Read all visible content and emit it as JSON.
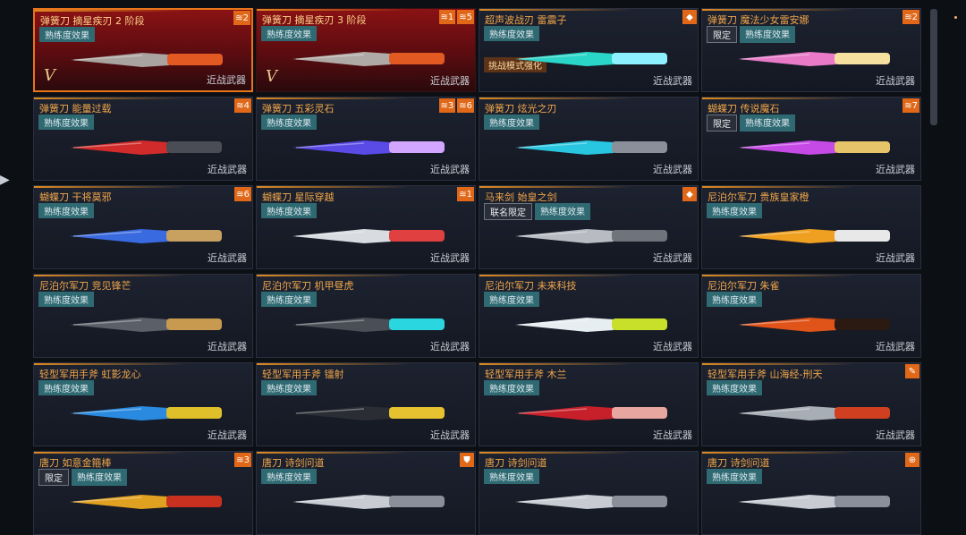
{
  "cards": [
    {
      "title": "弹簧刀 摘星疾刃 2 阶段",
      "tags": [
        {
          "t": "熟练度效果",
          "k": "fx"
        }
      ],
      "category": "近战武器",
      "badges": [
        "≋2"
      ],
      "style": "red sel",
      "v": "V",
      "c1": "#a9a4a0",
      "c2": "#e25a22"
    },
    {
      "title": "弹簧刀 摘星疾刃 3 阶段",
      "tags": [
        {
          "t": "熟练度效果",
          "k": "fx"
        }
      ],
      "category": "近战武器",
      "badges": [
        "≋1",
        "≋5"
      ],
      "style": "red",
      "v": "V",
      "c1": "#b0aaa6",
      "c2": "#e25a22"
    },
    {
      "title": "超声波战刃 雷震子",
      "tags": [
        {
          "t": "熟练度效果",
          "k": "fx"
        }
      ],
      "mode": "挑战模式强化",
      "category": "近战武器",
      "badges": [
        "◆"
      ],
      "style": "",
      "c1": "#2ad6c8",
      "c2": "#8cf0ff"
    },
    {
      "title": "弹簧刀 魔法少女雷安娜",
      "tags": [
        {
          "t": "限定",
          "k": "limit2"
        },
        {
          "t": "熟练度效果",
          "k": "fx"
        }
      ],
      "category": "近战武器",
      "badges": [
        "≋2"
      ],
      "style": "",
      "c1": "#e87ac8",
      "c2": "#f5e0a0"
    },
    {
      "title": "弹簧刀 能量过载",
      "tags": [
        {
          "t": "熟练度效果",
          "k": "fx"
        }
      ],
      "category": "近战武器",
      "badges": [
        "≋4"
      ],
      "style": "",
      "c1": "#d22b2b",
      "c2": "#4a4d55"
    },
    {
      "title": "弹簧刀 五彩灵石",
      "tags": [
        {
          "t": "熟练度效果",
          "k": "fx"
        }
      ],
      "category": "近战武器",
      "badges": [
        "≋3",
        "≋6"
      ],
      "style": "",
      "c1": "#5a4ae6",
      "c2": "#d2a6ff"
    },
    {
      "title": "弹簧刀 炫光之刃",
      "tags": [
        {
          "t": "熟练度效果",
          "k": "fx"
        }
      ],
      "category": "近战武器",
      "badges": [],
      "style": "",
      "c1": "#28c6e0",
      "c2": "#8a8f99"
    },
    {
      "title": "蝴蝶刀 传说魔石",
      "tags": [
        {
          "t": "限定",
          "k": "limit2"
        },
        {
          "t": "熟练度效果",
          "k": "fx"
        }
      ],
      "category": "近战武器",
      "badges": [
        "≋7"
      ],
      "style": "",
      "c1": "#c64ae6",
      "c2": "#e6c46a"
    },
    {
      "title": "蝴蝶刀 干将莫邪",
      "tags": [
        {
          "t": "熟练度效果",
          "k": "fx"
        }
      ],
      "category": "近战武器",
      "badges": [
        "≋6"
      ],
      "style": "",
      "c1": "#3a6ae0",
      "c2": "#c8a060"
    },
    {
      "title": "蝴蝶刀 星际穿越",
      "tags": [
        {
          "t": "熟练度效果",
          "k": "fx"
        }
      ],
      "category": "近战武器",
      "badges": [
        "≋1"
      ],
      "style": "",
      "c1": "#d8dbe0",
      "c2": "#e04040"
    },
    {
      "title": "马来剑 始皇之剑",
      "tags": [
        {
          "t": "联名限定",
          "k": "limit2"
        },
        {
          "t": "熟练度效果",
          "k": "fx"
        }
      ],
      "category": "近战武器",
      "badges": [
        "◆"
      ],
      "style": "",
      "c1": "#b8bcc2",
      "c2": "#6f747c"
    },
    {
      "title": "尼泊尔军刀 贵族皇家橙",
      "tags": [
        {
          "t": "熟练度效果",
          "k": "fx"
        }
      ],
      "category": "近战武器",
      "badges": [],
      "style": "",
      "c1": "#f0a020",
      "c2": "#e8e8e8"
    },
    {
      "title": "尼泊尔军刀 竞见锋芒",
      "tags": [
        {
          "t": "熟练度效果",
          "k": "fx"
        }
      ],
      "category": "近战武器",
      "badges": [],
      "style": "",
      "c1": "#5a5f68",
      "c2": "#c89a50"
    },
    {
      "title": "尼泊尔军刀 机甲昼虎",
      "tags": [
        {
          "t": "熟练度效果",
          "k": "fx"
        }
      ],
      "category": "近战武器",
      "badges": [],
      "style": "",
      "c1": "#4a4e56",
      "c2": "#2ad6e0"
    },
    {
      "title": "尼泊尔军刀 未来科技",
      "tags": [
        {
          "t": "熟练度效果",
          "k": "fx"
        }
      ],
      "category": "近战武器",
      "badges": [],
      "style": "",
      "c1": "#e6eef2",
      "c2": "#c8e02a"
    },
    {
      "title": "尼泊尔军刀 朱雀",
      "tags": [
        {
          "t": "熟练度效果",
          "k": "fx"
        }
      ],
      "category": "近战武器",
      "badges": [],
      "style": "",
      "c1": "#e0541a",
      "c2": "#2a1a12"
    },
    {
      "title": "轻型军用手斧 虹影龙心",
      "tags": [
        {
          "t": "熟练度效果",
          "k": "fx"
        }
      ],
      "category": "近战武器",
      "badges": [],
      "style": "",
      "c1": "#2a8ae0",
      "c2": "#e0c02a"
    },
    {
      "title": "轻型军用手斧 镭射",
      "tags": [
        {
          "t": "熟练度效果",
          "k": "fx"
        }
      ],
      "category": "近战武器",
      "badges": [],
      "style": "",
      "c1": "#2a2d33",
      "c2": "#e6c230"
    },
    {
      "title": "轻型军用手斧 木兰",
      "tags": [
        {
          "t": "熟练度效果",
          "k": "fx"
        }
      ],
      "category": "近战武器",
      "badges": [],
      "style": "",
      "c1": "#c8202a",
      "c2": "#e8a6a0"
    },
    {
      "title": "轻型军用手斧 山海经-刑天",
      "tags": [
        {
          "t": "熟练度效果",
          "k": "fx"
        }
      ],
      "category": "近战武器",
      "badges": [
        "✎"
      ],
      "style": "",
      "c1": "#a8aeb6",
      "c2": "#d04020"
    },
    {
      "title": "唐刀 如意金箍棒",
      "tags": [
        {
          "t": "限定",
          "k": "limit2"
        },
        {
          "t": "熟练度效果",
          "k": "fx"
        }
      ],
      "category": "",
      "badges": [
        "≋3"
      ],
      "style": "",
      "c1": "#e0a020",
      "c2": "#c83020"
    },
    {
      "title": "唐刀 诗剑问道",
      "tags": [
        {
          "t": "熟练度效果",
          "k": "fx"
        }
      ],
      "category": "",
      "badges": [
        "⛊"
      ],
      "style": "",
      "c1": "#c8ccd2",
      "c2": "#8a8f99"
    },
    {
      "title": "唐刀 诗剑问道",
      "tags": [
        {
          "t": "熟练度效果",
          "k": "fx"
        }
      ],
      "category": "",
      "badges": [],
      "style": "",
      "c1": "#c8ccd2",
      "c2": "#8a8f99"
    },
    {
      "title": "唐刀 诗剑问道",
      "tags": [
        {
          "t": "熟练度效果",
          "k": "fx"
        }
      ],
      "category": "",
      "badges": [
        "⊕"
      ],
      "style": "",
      "c1": "#c8ccd2",
      "c2": "#8a8f99"
    }
  ],
  "side_arrow": "▶"
}
